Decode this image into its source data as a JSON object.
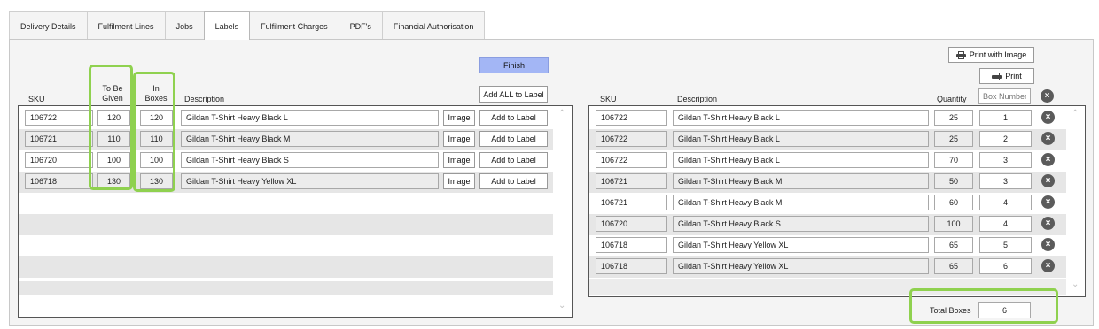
{
  "tabs": [
    {
      "label": "Delivery Details"
    },
    {
      "label": "Fulfilment Lines"
    },
    {
      "label": "Jobs"
    },
    {
      "label": "Labels"
    },
    {
      "label": "Fulfilment Charges"
    },
    {
      "label": "PDF's"
    },
    {
      "label": "Financial Authorisation"
    }
  ],
  "active_tab": "Labels",
  "left": {
    "finish_label": "Finish",
    "add_all_label": "Add ALL to Label",
    "headers": {
      "sku": "SKU",
      "to_be_given": "To Be\nGiven",
      "in_boxes": "In\nBoxes",
      "description": "Description"
    },
    "image_label": "Image",
    "add_to_label": "Add to Label",
    "rows": [
      {
        "sku": "106722",
        "to_be_given": "120",
        "in_boxes": "120",
        "description": "Gildan T-Shirt Heavy Black L"
      },
      {
        "sku": "106721",
        "to_be_given": "110",
        "in_boxes": "110",
        "description": "Gildan T-Shirt Heavy Black M"
      },
      {
        "sku": "106720",
        "to_be_given": "100",
        "in_boxes": "100",
        "description": "Gildan T-Shirt Heavy Black S"
      },
      {
        "sku": "106718",
        "to_be_given": "130",
        "in_boxes": "130",
        "description": "Gildan T-Shirt Heavy Yellow XL"
      }
    ]
  },
  "right": {
    "print_with_image_label": "Print with Image",
    "print_label": "Print",
    "headers": {
      "sku": "SKU",
      "description": "Description",
      "quantity": "Quantity"
    },
    "box_number_placeholder": "Box Number",
    "rows": [
      {
        "sku": "106722",
        "description": "Gildan T-Shirt Heavy Black L",
        "quantity": "25",
        "box": "1"
      },
      {
        "sku": "106722",
        "description": "Gildan T-Shirt Heavy Black L",
        "quantity": "25",
        "box": "2"
      },
      {
        "sku": "106722",
        "description": "Gildan T-Shirt Heavy Black L",
        "quantity": "70",
        "box": "3"
      },
      {
        "sku": "106721",
        "description": "Gildan T-Shirt Heavy Black M",
        "quantity": "50",
        "box": "3"
      },
      {
        "sku": "106721",
        "description": "Gildan T-Shirt Heavy Black M",
        "quantity": "60",
        "box": "4"
      },
      {
        "sku": "106720",
        "description": "Gildan T-Shirt Heavy Black S",
        "quantity": "100",
        "box": "4"
      },
      {
        "sku": "106718",
        "description": "Gildan T-Shirt Heavy Yellow XL",
        "quantity": "65",
        "box": "5"
      },
      {
        "sku": "106718",
        "description": "Gildan T-Shirt Heavy Yellow XL",
        "quantity": "65",
        "box": "6"
      }
    ],
    "total_boxes_label": "Total Boxes",
    "total_boxes_value": "6"
  },
  "colors": {
    "highlight": "#8fd14f",
    "finish_button": "#a3b6f5"
  }
}
